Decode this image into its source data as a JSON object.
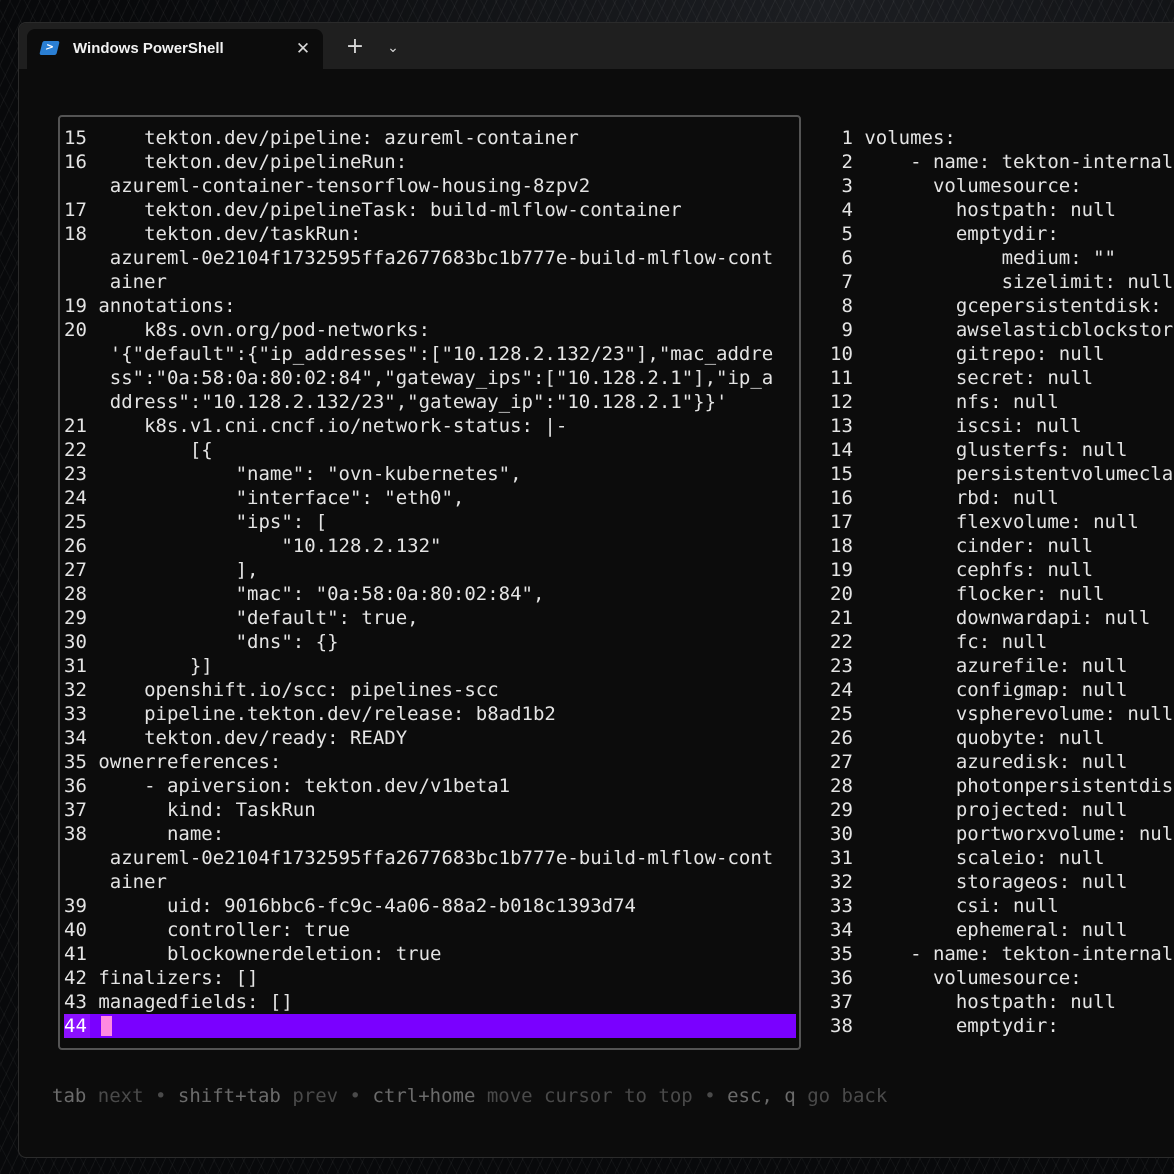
{
  "tab": {
    "title": "Windows PowerShell",
    "close": "✕",
    "new_tab": "+",
    "dropdown": "⌄",
    "icon": "powershell-icon"
  },
  "left_lines": [
    "15     tekton.dev/pipeline: azureml-container",
    "16     tekton.dev/pipelineRun:",
    "    azureml-container-tensorflow-housing-8zpv2",
    "17     tekton.dev/pipelineTask: build-mlflow-container",
    "18     tekton.dev/taskRun:",
    "    azureml-0e2104f1732595ffa2677683bc1b777e-build-mlflow-cont",
    "    ainer",
    "19 annotations:",
    "20     k8s.ovn.org/pod-networks:",
    "    '{\"default\":{\"ip_addresses\":[\"10.128.2.132/23\"],\"mac_addre",
    "    ss\":\"0a:58:0a:80:02:84\",\"gateway_ips\":[\"10.128.2.1\"],\"ip_a",
    "    ddress\":\"10.128.2.132/23\",\"gateway_ip\":\"10.128.2.1\"}}'",
    "21     k8s.v1.cni.cncf.io/network-status: |-",
    "22         [{",
    "23             \"name\": \"ovn-kubernetes\",",
    "24             \"interface\": \"eth0\",",
    "25             \"ips\": [",
    "26                 \"10.128.2.132\"",
    "27             ],",
    "28             \"mac\": \"0a:58:0a:80:02:84\",",
    "29             \"default\": true,",
    "30             \"dns\": {}",
    "31         }]",
    "32     openshift.io/scc: pipelines-scc",
    "33     pipeline.tekton.dev/release: b8ad1b2",
    "34     tekton.dev/ready: READY",
    "35 ownerreferences:",
    "36     - apiversion: tekton.dev/v1beta1",
    "37       kind: TaskRun",
    "38       name:",
    "    azureml-0e2104f1732595ffa2677683bc1b777e-build-mlflow-cont",
    "    ainer",
    "39       uid: 9016bbc6-fc9c-4a06-88a2-b018c1393d74",
    "40       controller: true",
    "41       blockownerdeletion: true",
    "42 finalizers: []",
    "43 managedfields: []"
  ],
  "current_line": "44",
  "right_lines": [
    " 1 volumes:",
    " 2     - name: tekton-internal",
    " 3       volumesource:",
    " 4         hostpath: null",
    " 5         emptydir:",
    " 6             medium: \"\"",
    " 7             sizelimit: null",
    " 8         gcepersistentdisk: ",
    " 9         awselasticblockstor",
    "10         gitrepo: null",
    "11         secret: null",
    "12         nfs: null",
    "13         iscsi: null",
    "14         glusterfs: null",
    "15         persistentvolumecla",
    "16         rbd: null",
    "17         flexvolume: null",
    "18         cinder: null",
    "19         cephfs: null",
    "20         flocker: null",
    "21         downwardapi: null",
    "22         fc: null",
    "23         azurefile: null",
    "24         configmap: null",
    "25         vspherevolume: null",
    "26         quobyte: null",
    "27         azuredisk: null",
    "28         photonpersistentdis",
    "29         projected: null",
    "30         portworxvolume: nul",
    "31         scaleio: null",
    "32         storageos: null",
    "33         csi: null",
    "34         ephemeral: null",
    "35     - name: tekton-internal",
    "36       volumesource:",
    "37         hostpath: null",
    "38         emptydir:"
  ],
  "footer": {
    "tab_key": "tab",
    "tab_desc": "next",
    "shift_key": "shift+tab",
    "shift_desc": "prev",
    "home_key": "ctrl+home",
    "home_desc": "move cursor to top",
    "esc_key": "esc, q",
    "esc_desc": "go back",
    "sep": "•"
  }
}
